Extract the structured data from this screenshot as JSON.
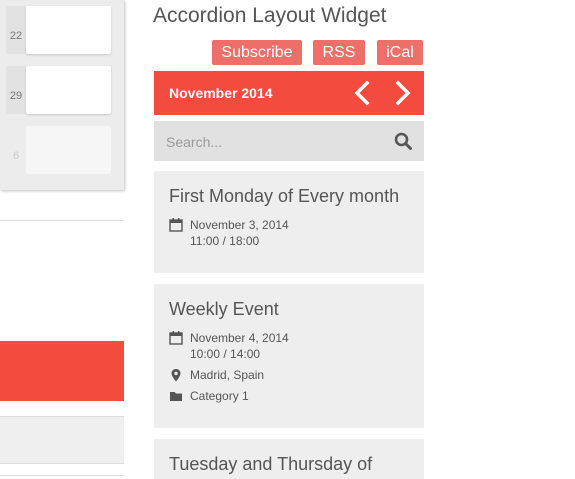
{
  "calendar": {
    "days": [
      "22",
      "29",
      "6"
    ]
  },
  "widget": {
    "title": "Accordion Layout Widget",
    "buttons": {
      "subscribe": "Subscribe",
      "rss": "RSS",
      "ical": "iCal"
    },
    "month_label": "November 2014",
    "search": {
      "placeholder": "Search...",
      "value": ""
    },
    "accent_color": "#f44b3f",
    "events": [
      {
        "title": "First Monday of Every month",
        "date": "November 3, 2014",
        "time": "11:00 / 18:00"
      },
      {
        "title": "Weekly Event",
        "date": "November 4, 2014",
        "time": "10:00 / 14:00",
        "location": "Madrid, Spain",
        "category": "Category 1"
      },
      {
        "title": "Tuesday and Thursday of"
      }
    ]
  },
  "icons": {
    "prev": "chevron-left-icon",
    "next": "chevron-right-icon",
    "search": "search-icon",
    "date": "calendar-icon",
    "location": "map-pin-icon",
    "category": "folder-icon"
  }
}
